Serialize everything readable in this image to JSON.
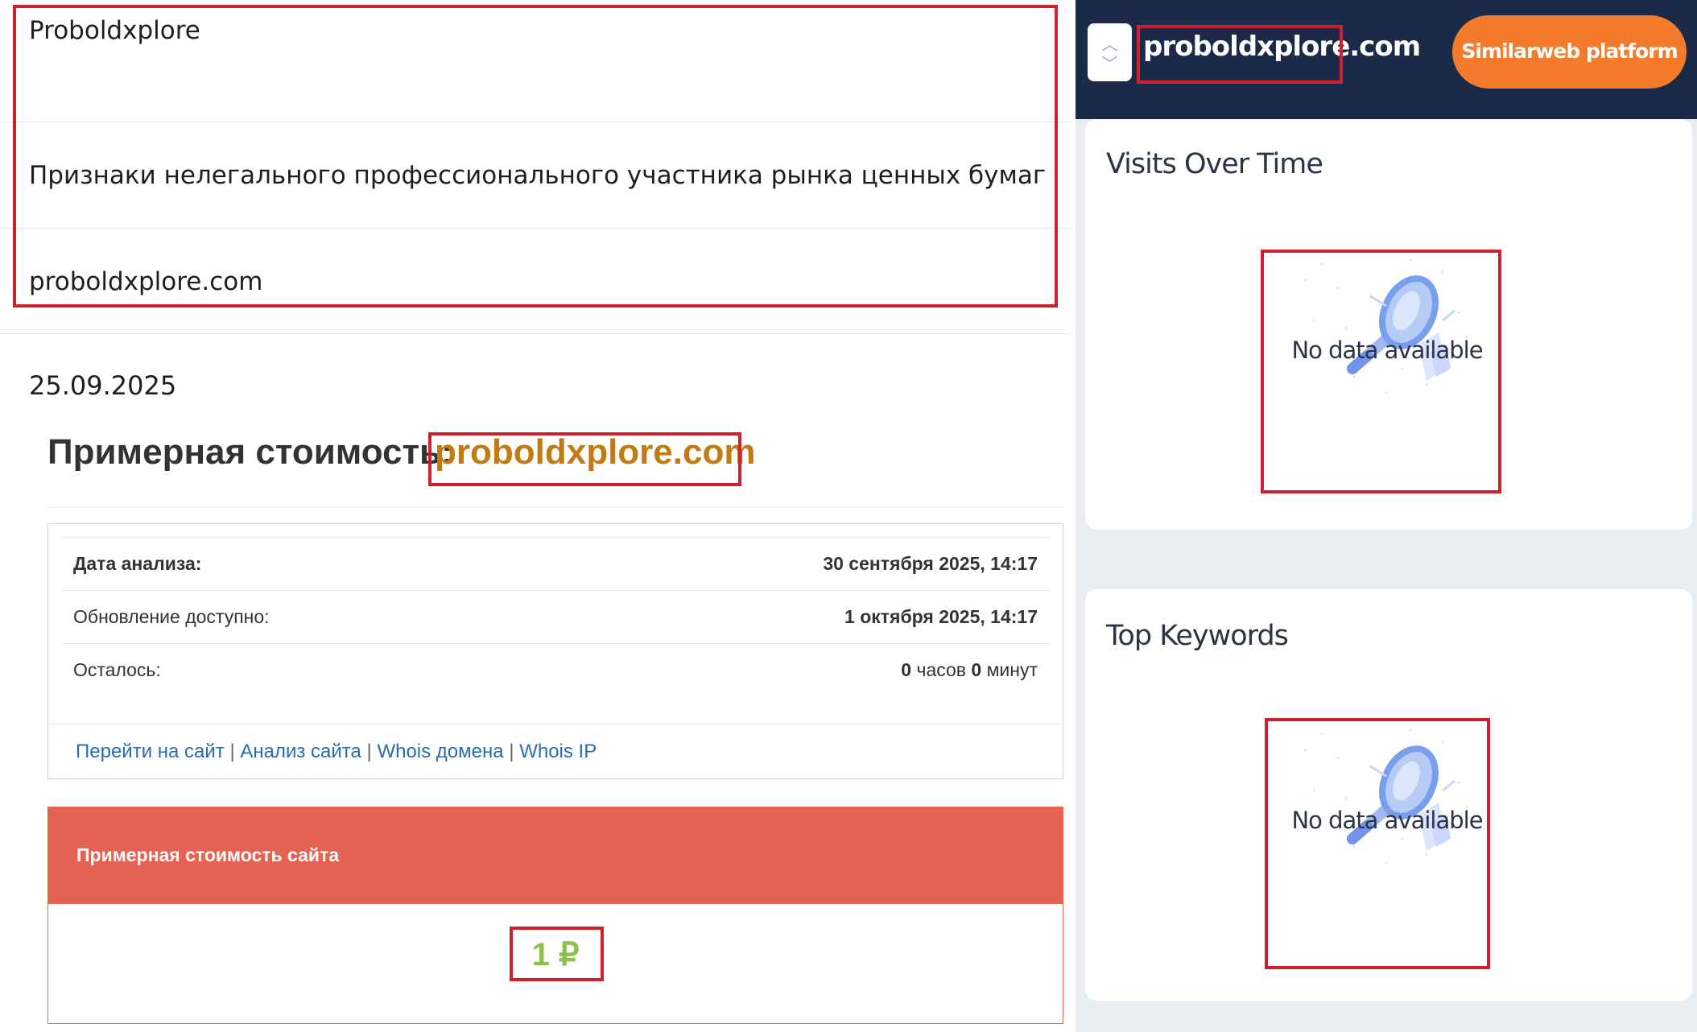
{
  "left": {
    "site_name": "Proboldxplore",
    "warning_text": "Признаки нелегального профессионального участника рынка ценных бумаг",
    "domain": "proboldxplore.com",
    "date": "25.09.2025",
    "cost_heading": "Примерная стоимость:",
    "cost_domain": "proboldxplore.com",
    "analysis": {
      "rows": [
        {
          "label": "Дата анализа:",
          "value": "30 сентября 2025, 14:17"
        },
        {
          "label": "Обновление доступно:",
          "value": "1 октября 2025, 14:17"
        }
      ],
      "remaining": {
        "label": "Осталось:",
        "hours_num": "0",
        "hours_word": "часов",
        "minutes_num": "0",
        "minutes_word": "минут"
      },
      "links": [
        {
          "label": "Перейти на сайт"
        },
        {
          "label": "Анализ сайта"
        },
        {
          "label": "Whois домена"
        },
        {
          "label": "Whois IP"
        }
      ],
      "separator": "|"
    },
    "estimate": {
      "title": "Примерная стоимость сайта",
      "value": "1 ₽"
    }
  },
  "right": {
    "domain": "proboldxplore.com",
    "platform_button": "Similarweb platform",
    "visits_card": {
      "title": "Visits Over Time",
      "empty_text": "No data available",
      "icon": "magnifier-icon"
    },
    "keywords_card": {
      "title": "Top Keywords",
      "empty_text": "No data available",
      "icon": "magnifier-icon"
    }
  },
  "colors": {
    "highlight_border": "#d0202e",
    "cost_domain": "#c47a12",
    "estimate_header": "#e56352",
    "estimate_value": "#8bc34a",
    "link": "#2b6cb0",
    "topbar": "#1b2a49",
    "platform_button": "#f37b2b"
  }
}
